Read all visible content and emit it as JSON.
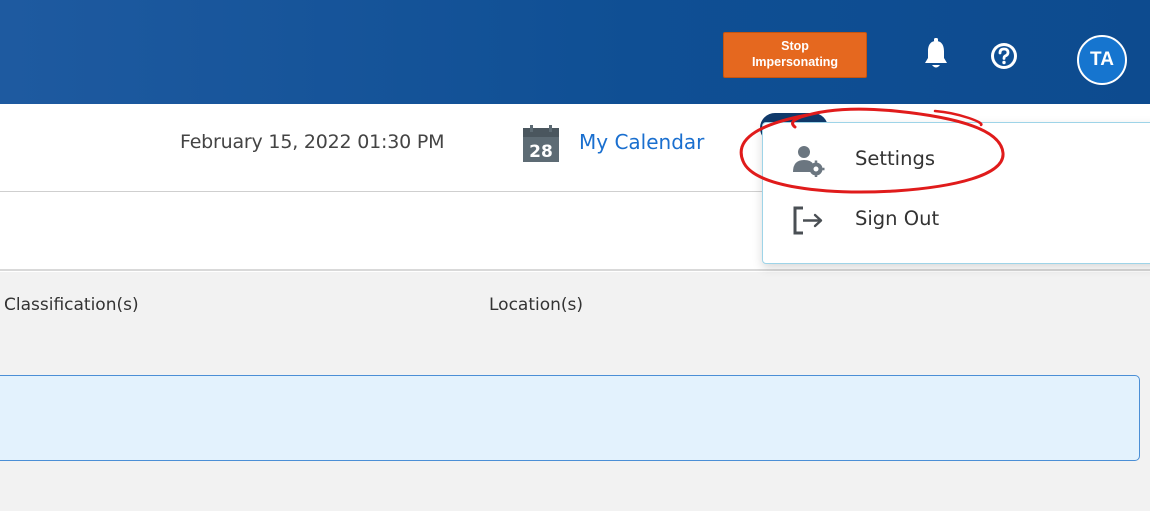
{
  "header": {
    "stop_impersonating": {
      "line1": "Stop",
      "line2": "Impersonating"
    },
    "icons": {
      "notifications": "bell-icon",
      "help": "help-circle-icon"
    },
    "avatar_initials": "TA"
  },
  "subheader": {
    "datetime": "February 15, 2022 01:30 PM",
    "calendar_icon_day": "28",
    "calendar_link": "My Calendar"
  },
  "table": {
    "columns": [
      "Classification(s)",
      "Location(s)"
    ]
  },
  "user_menu": {
    "items": [
      {
        "label": "Settings",
        "icon": "user-settings-icon"
      },
      {
        "label": "Sign Out",
        "icon": "sign-out-icon"
      }
    ]
  },
  "colors": {
    "header_bg": "#0f4f94",
    "stop_button": "#e5681f",
    "avatar": "#1675cf",
    "link": "#1a6fcf",
    "annotation": "#e01b1b",
    "row_highlight": "#e3f2fd"
  }
}
